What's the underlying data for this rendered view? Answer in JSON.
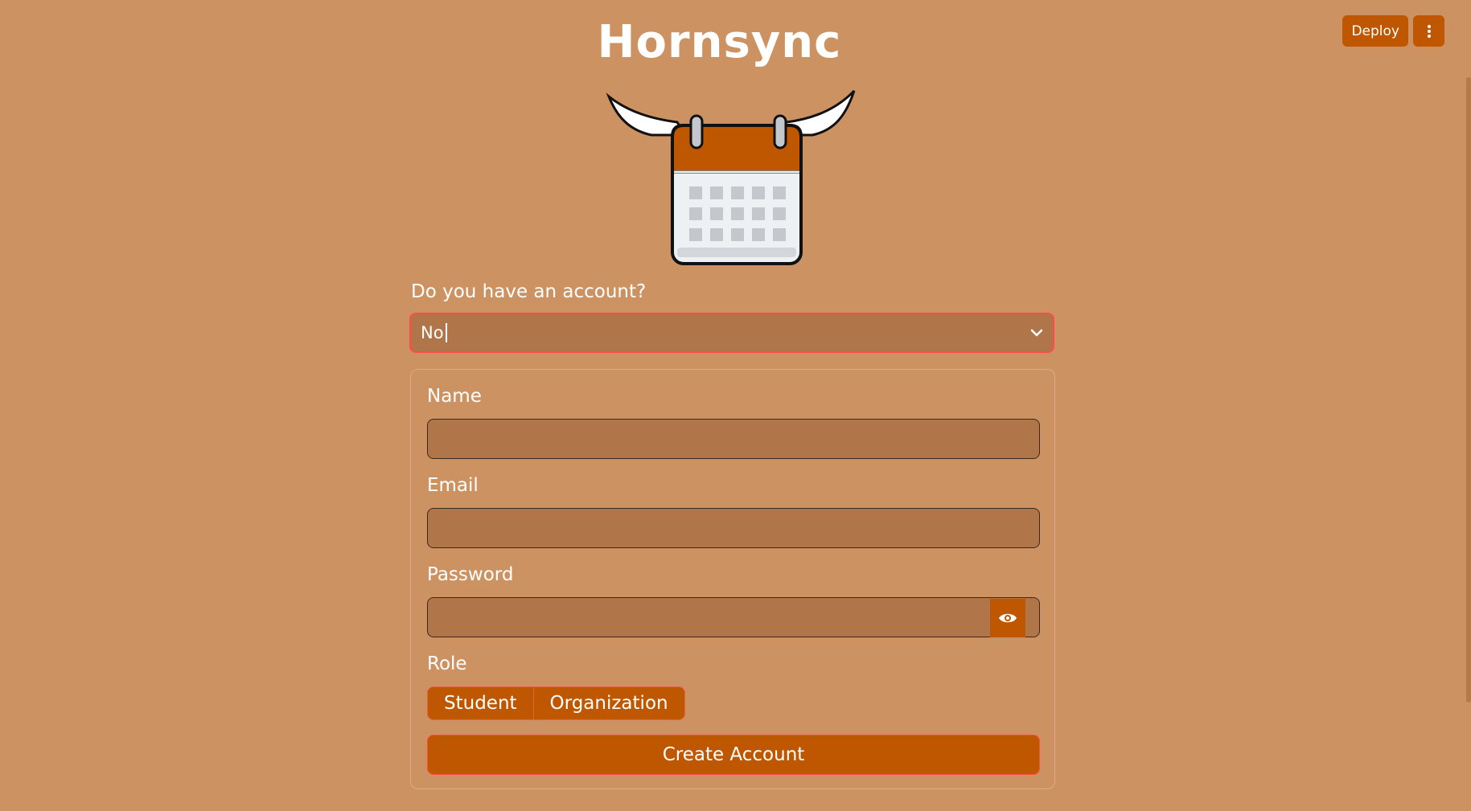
{
  "app": {
    "title": "Hornsync",
    "logo_icon": "longhorn-calendar-icon"
  },
  "toolbar": {
    "deploy_label": "Deploy",
    "menu_icon": "vertical-dots-icon"
  },
  "account": {
    "question": "Do you have an account?",
    "selected": "No"
  },
  "form": {
    "name_label": "Name",
    "email_label": "Email",
    "password_label": "Password",
    "role_label": "Role",
    "roles": [
      "Student",
      "Organization"
    ],
    "submit_label": "Create Account"
  },
  "colors": {
    "background": "#CD9261",
    "accent": "#BF5700",
    "input_bg": "#B0764A",
    "focus_border": "#FF4B4B"
  }
}
